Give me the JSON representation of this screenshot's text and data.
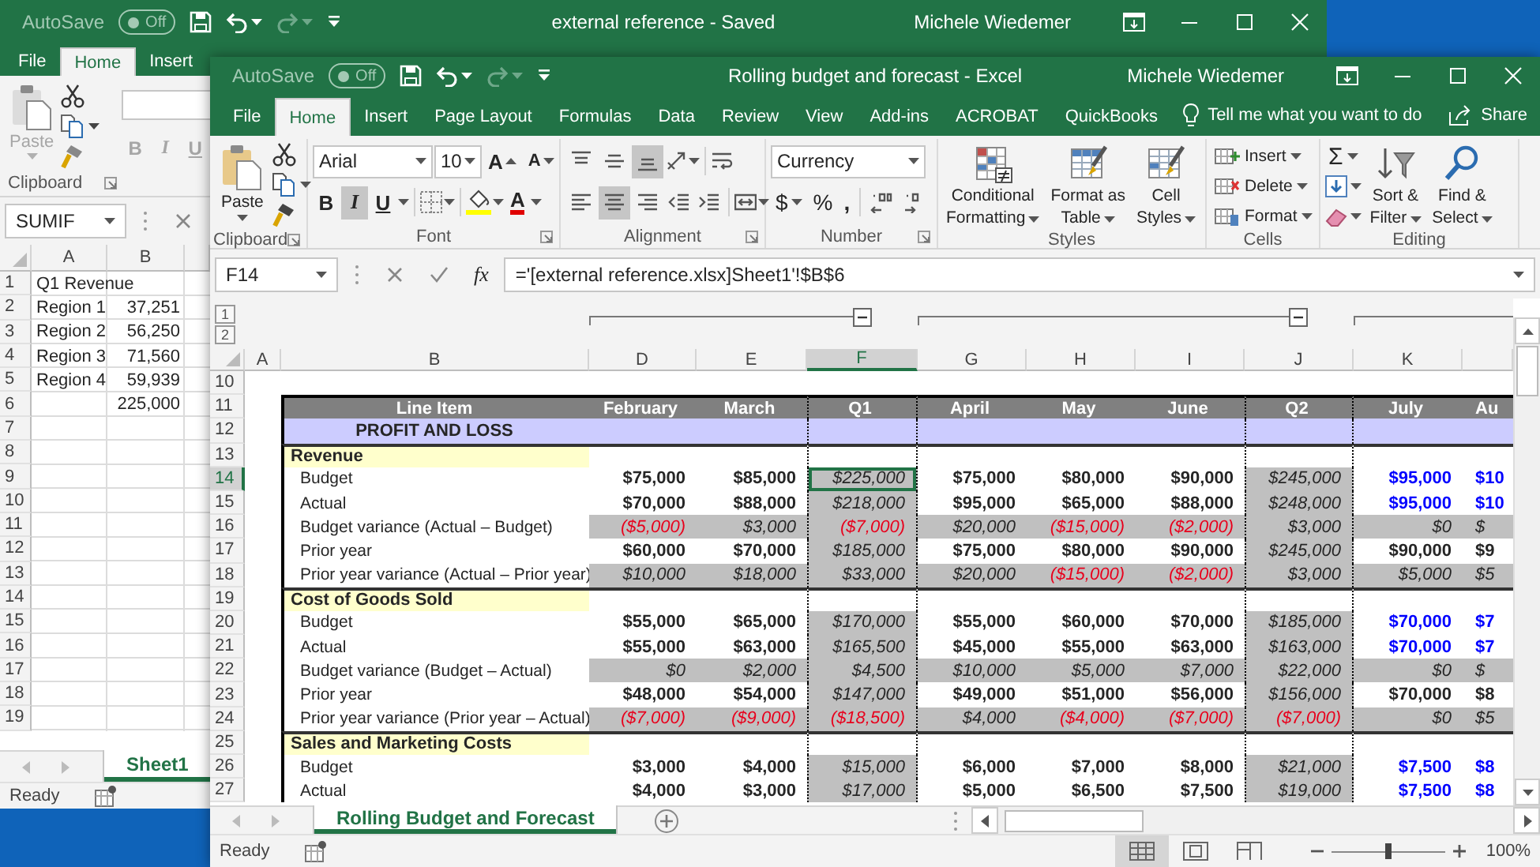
{
  "back_window": {
    "title_bar": {
      "autosave": {
        "label": "AutoSave",
        "state_text": "Off",
        "on": false
      },
      "title": "external reference - Saved",
      "user": "Michele Wiedemer"
    },
    "tabs": [
      {
        "label": "File",
        "selected": false
      },
      {
        "label": "Home",
        "selected": true
      },
      {
        "label": "Insert",
        "selected": false
      }
    ],
    "ribbon": {
      "disabled": true,
      "paste": "Paste",
      "group_label": "Clipboard",
      "styles": [
        "B",
        "I",
        "U"
      ]
    },
    "formula_bar": {
      "name_box": "SUMIF"
    },
    "sheet": {
      "columns": [
        "A",
        "B"
      ],
      "rows": [
        {
          "number": "1",
          "a": "Q1 Revenue"
        },
        {
          "number": "2",
          "a": "Region 1",
          "b": "37,251"
        },
        {
          "number": "3",
          "a": "Region 2",
          "b": "56,250"
        },
        {
          "number": "4",
          "a": "Region 3",
          "b": "71,560"
        },
        {
          "number": "5",
          "a": "Region 4",
          "b": "59,939"
        },
        {
          "number": "6",
          "b": "225,000"
        },
        {
          "number": "7"
        },
        {
          "number": "8"
        },
        {
          "number": "9"
        },
        {
          "number": "10"
        },
        {
          "number": "11"
        },
        {
          "number": "12"
        },
        {
          "number": "13"
        },
        {
          "number": "14"
        },
        {
          "number": "15"
        },
        {
          "number": "16"
        },
        {
          "number": "17"
        },
        {
          "number": "18"
        },
        {
          "number": "19"
        }
      ]
    },
    "sheet_tabs": [
      {
        "label": "Sheet1",
        "selected": true
      }
    ],
    "status": {
      "text": "Ready"
    }
  },
  "front_window": {
    "title_bar": {
      "autosave": {
        "label": "AutoSave",
        "state_text": "Off",
        "on": false
      },
      "title": "Rolling budget and forecast - Excel",
      "user": "Michele Wiedemer"
    },
    "tabs": [
      {
        "label": "File",
        "selected": false
      },
      {
        "label": "Home",
        "selected": true
      },
      {
        "label": "Insert",
        "selected": false
      },
      {
        "label": "Page Layout",
        "selected": false
      },
      {
        "label": "Formulas",
        "selected": false
      },
      {
        "label": "Data",
        "selected": false
      },
      {
        "label": "Review",
        "selected": false
      },
      {
        "label": "View",
        "selected": false
      },
      {
        "label": "Add-ins",
        "selected": false
      },
      {
        "label": "ACROBAT",
        "selected": false
      },
      {
        "label": "QuickBooks",
        "selected": false
      }
    ],
    "tell_me": "Tell me what you want to do",
    "share": "Share",
    "ribbon": {
      "groups": [
        {
          "kind": "clipboard",
          "label": "Clipboard",
          "launcher": true,
          "paste": "Paste"
        },
        {
          "kind": "font",
          "label": "Font",
          "launcher": true,
          "font_name": "Arial",
          "font_size": "10",
          "grow_label": "A",
          "shrink_label": "A",
          "styles": [
            {
              "glyph": "B",
              "selected": false
            },
            {
              "glyph": "I",
              "selected": true
            },
            {
              "glyph": "U",
              "selected": false
            }
          ],
          "color_label": "A"
        },
        {
          "kind": "alignment",
          "label": "Alignment",
          "launcher": true,
          "vertical": [
            {
              "selected": false
            },
            {
              "selected": false
            },
            {
              "selected": true
            }
          ],
          "horizontal": [
            {
              "selected": false
            },
            {
              "selected": true
            },
            {
              "selected": false
            }
          ]
        },
        {
          "kind": "number",
          "label": "Number",
          "launcher": true,
          "format": "Currency",
          "symbols": [
            "$",
            "%",
            ","
          ]
        },
        {
          "kind": "styles",
          "label": "Styles",
          "launcher": false,
          "buttons": [
            {
              "kind": "conditional",
              "lines": [
                "Conditional",
                "Formatting"
              ]
            },
            {
              "kind": "table",
              "lines": [
                "Format as",
                "Table"
              ]
            },
            {
              "kind": "cell_styles",
              "lines": [
                "Cell",
                "Styles"
              ]
            }
          ]
        },
        {
          "kind": "cells",
          "label": "Cells",
          "launcher": false,
          "buttons": [
            {
              "kind": "insert",
              "label": "Insert"
            },
            {
              "kind": "delete",
              "label": "Delete"
            },
            {
              "kind": "format",
              "label": "Format"
            }
          ]
        },
        {
          "kind": "editing",
          "label": "Editing",
          "launcher": false,
          "autosum": "Σ",
          "buttons": [
            {
              "kind": "sort",
              "lines": [
                "Sort &",
                "Filter"
              ]
            },
            {
              "kind": "find",
              "lines": [
                "Find &",
                "Select"
              ]
            }
          ]
        }
      ]
    },
    "formula_bar": {
      "name_box": "F14",
      "function_label": "fx",
      "formula": "='[external reference.xlsx]Sheet1'!$B$6"
    },
    "outline": {
      "levels": [
        "1",
        "2"
      ],
      "groups": [
        {
          "expanded": true
        },
        {
          "expanded": true
        }
      ]
    },
    "sheet": {
      "fixed_columns": [
        "A",
        "B"
      ],
      "columns": [
        {
          "letter": "D",
          "quarter": false,
          "selected": false
        },
        {
          "letter": "E",
          "quarter": false,
          "selected": false
        },
        {
          "letter": "F",
          "quarter": true,
          "selected": true
        },
        {
          "letter": "G",
          "quarter": false,
          "selected": false
        },
        {
          "letter": "H",
          "quarter": false,
          "selected": false
        },
        {
          "letter": "I",
          "quarter": false,
          "selected": false
        },
        {
          "letter": "J",
          "quarter": true,
          "selected": false
        },
        {
          "letter": "K",
          "quarter": false,
          "selected": false
        },
        {
          "quarter": false,
          "selected": false
        }
      ],
      "rows": [
        {
          "number": "10",
          "kind": "blank",
          "selected": false
        },
        {
          "number": "11",
          "kind": "header",
          "selected": false,
          "label": "Line Item",
          "cells": [
            {
              "text": "February"
            },
            {
              "text": "March"
            },
            {
              "text": "Q1"
            },
            {
              "text": "April"
            },
            {
              "text": "May"
            },
            {
              "text": "June"
            },
            {
              "text": "Q2"
            },
            {
              "text": "July"
            },
            {
              "text": "Au"
            }
          ]
        },
        {
          "number": "12",
          "kind": "title",
          "selected": false,
          "label": "PROFIT AND LOSS"
        },
        {
          "number": "13",
          "kind": "section",
          "selected": false,
          "label": "Revenue"
        },
        {
          "number": "14",
          "kind": "line",
          "selected": true,
          "label": "Budget",
          "cells": [
            {
              "text": "$75,000",
              "kind": "plain"
            },
            {
              "text": "$85,000",
              "kind": "plain"
            },
            {
              "text": "$225,000",
              "kind": "plain"
            },
            {
              "text": "$75,000",
              "kind": "plain"
            },
            {
              "text": "$80,000",
              "kind": "plain"
            },
            {
              "text": "$90,000",
              "kind": "plain"
            },
            {
              "text": "$245,000",
              "kind": "plain"
            },
            {
              "text": "$95,000",
              "kind": "forecast"
            },
            {
              "text": "$10",
              "kind": "forecast"
            }
          ]
        },
        {
          "number": "15",
          "kind": "line",
          "selected": false,
          "label": "Actual",
          "cells": [
            {
              "text": "$70,000",
              "kind": "plain"
            },
            {
              "text": "$88,000",
              "kind": "plain"
            },
            {
              "text": "$218,000",
              "kind": "plain"
            },
            {
              "text": "$95,000",
              "kind": "plain"
            },
            {
              "text": "$65,000",
              "kind": "plain"
            },
            {
              "text": "$88,000",
              "kind": "plain"
            },
            {
              "text": "$248,000",
              "kind": "plain"
            },
            {
              "text": "$95,000",
              "kind": "forecast"
            },
            {
              "text": "$10",
              "kind": "forecast"
            }
          ]
        },
        {
          "number": "16",
          "kind": "variance",
          "selected": false,
          "label": "Budget variance (Actual – Budget)",
          "cells": [
            {
              "text": "($5,000)",
              "kind": "negative"
            },
            {
              "text": "$3,000",
              "kind": "plain"
            },
            {
              "text": "($7,000)",
              "kind": "negative"
            },
            {
              "text": "$20,000",
              "kind": "plain"
            },
            {
              "text": "($15,000)",
              "kind": "negative"
            },
            {
              "text": "($2,000)",
              "kind": "negative"
            },
            {
              "text": "$3,000",
              "kind": "plain"
            },
            {
              "text": "$0",
              "kind": "plain"
            },
            {
              "text": "$",
              "kind": "plain"
            }
          ]
        },
        {
          "number": "17",
          "kind": "line",
          "selected": false,
          "label": "Prior year",
          "cells": [
            {
              "text": "$60,000",
              "kind": "plain"
            },
            {
              "text": "$70,000",
              "kind": "plain"
            },
            {
              "text": "$185,000",
              "kind": "plain"
            },
            {
              "text": "$75,000",
              "kind": "plain"
            },
            {
              "text": "$80,000",
              "kind": "plain"
            },
            {
              "text": "$90,000",
              "kind": "plain"
            },
            {
              "text": "$245,000",
              "kind": "plain"
            },
            {
              "text": "$90,000",
              "kind": "plain"
            },
            {
              "text": "$9",
              "kind": "plain"
            }
          ]
        },
        {
          "number": "18",
          "kind": "variance",
          "selected": false,
          "label": "Prior year variance (Actual – Prior year)",
          "cells": [
            {
              "text": "$10,000",
              "kind": "plain"
            },
            {
              "text": "$18,000",
              "kind": "plain"
            },
            {
              "text": "$33,000",
              "kind": "plain"
            },
            {
              "text": "$20,000",
              "kind": "plain"
            },
            {
              "text": "($15,000)",
              "kind": "negative"
            },
            {
              "text": "($2,000)",
              "kind": "negative"
            },
            {
              "text": "$3,000",
              "kind": "plain"
            },
            {
              "text": "$5,000",
              "kind": "plain"
            },
            {
              "text": "$5",
              "kind": "plain"
            }
          ]
        },
        {
          "number": "19",
          "kind": "section",
          "selected": false,
          "label": "Cost of Goods Sold"
        },
        {
          "number": "20",
          "kind": "line",
          "selected": false,
          "label": "Budget",
          "cells": [
            {
              "text": "$55,000",
              "kind": "plain"
            },
            {
              "text": "$65,000",
              "kind": "plain"
            },
            {
              "text": "$170,000",
              "kind": "plain"
            },
            {
              "text": "$55,000",
              "kind": "plain"
            },
            {
              "text": "$60,000",
              "kind": "plain"
            },
            {
              "text": "$70,000",
              "kind": "plain"
            },
            {
              "text": "$185,000",
              "kind": "plain"
            },
            {
              "text": "$70,000",
              "kind": "forecast"
            },
            {
              "text": "$7",
              "kind": "forecast"
            }
          ]
        },
        {
          "number": "21",
          "kind": "line",
          "selected": false,
          "label": "Actual",
          "cells": [
            {
              "text": "$55,000",
              "kind": "plain"
            },
            {
              "text": "$63,000",
              "kind": "plain"
            },
            {
              "text": "$165,500",
              "kind": "plain"
            },
            {
              "text": "$45,000",
              "kind": "plain"
            },
            {
              "text": "$55,000",
              "kind": "plain"
            },
            {
              "text": "$63,000",
              "kind": "plain"
            },
            {
              "text": "$163,000",
              "kind": "plain"
            },
            {
              "text": "$70,000",
              "kind": "forecast"
            },
            {
              "text": "$7",
              "kind": "forecast"
            }
          ]
        },
        {
          "number": "22",
          "kind": "variance",
          "selected": false,
          "label": "Budget variance (Budget – Actual)",
          "cells": [
            {
              "text": "$0",
              "kind": "plain"
            },
            {
              "text": "$2,000",
              "kind": "plain"
            },
            {
              "text": "$4,500",
              "kind": "plain"
            },
            {
              "text": "$10,000",
              "kind": "plain"
            },
            {
              "text": "$5,000",
              "kind": "plain"
            },
            {
              "text": "$7,000",
              "kind": "plain"
            },
            {
              "text": "$22,000",
              "kind": "plain"
            },
            {
              "text": "$0",
              "kind": "plain"
            },
            {
              "text": "$",
              "kind": "plain"
            }
          ]
        },
        {
          "number": "23",
          "kind": "line",
          "selected": false,
          "label": "Prior year",
          "cells": [
            {
              "text": "$48,000",
              "kind": "plain"
            },
            {
              "text": "$54,000",
              "kind": "plain"
            },
            {
              "text": "$147,000",
              "kind": "plain"
            },
            {
              "text": "$49,000",
              "kind": "plain"
            },
            {
              "text": "$51,000",
              "kind": "plain"
            },
            {
              "text": "$56,000",
              "kind": "plain"
            },
            {
              "text": "$156,000",
              "kind": "plain"
            },
            {
              "text": "$70,000",
              "kind": "plain"
            },
            {
              "text": "$8",
              "kind": "plain"
            }
          ]
        },
        {
          "number": "24",
          "kind": "variance",
          "selected": false,
          "label": "Prior year variance (Prior year – Actual)",
          "cells": [
            {
              "text": "($7,000)",
              "kind": "negative"
            },
            {
              "text": "($9,000)",
              "kind": "negative"
            },
            {
              "text": "($18,500)",
              "kind": "negative"
            },
            {
              "text": "$4,000",
              "kind": "plain"
            },
            {
              "text": "($4,000)",
              "kind": "negative"
            },
            {
              "text": "($7,000)",
              "kind": "negative"
            },
            {
              "text": "($7,000)",
              "kind": "negative"
            },
            {
              "text": "$0",
              "kind": "plain"
            },
            {
              "text": "$5",
              "kind": "plain"
            }
          ]
        },
        {
          "number": "25",
          "kind": "section",
          "selected": false,
          "label": "Sales and Marketing Costs"
        },
        {
          "number": "26",
          "kind": "line",
          "selected": false,
          "label": "Budget",
          "cells": [
            {
              "text": "$3,000",
              "kind": "plain"
            },
            {
              "text": "$4,000",
              "kind": "plain"
            },
            {
              "text": "$15,000",
              "kind": "plain"
            },
            {
              "text": "$6,000",
              "kind": "plain"
            },
            {
              "text": "$7,000",
              "kind": "plain"
            },
            {
              "text": "$8,000",
              "kind": "plain"
            },
            {
              "text": "$21,000",
              "kind": "plain"
            },
            {
              "text": "$7,500",
              "kind": "forecast"
            },
            {
              "text": "$8",
              "kind": "forecast"
            }
          ]
        },
        {
          "number": "27",
          "kind": "line",
          "selected": false,
          "label": "Actual",
          "cells": [
            {
              "text": "$4,000",
              "kind": "plain"
            },
            {
              "text": "$3,000",
              "kind": "plain"
            },
            {
              "text": "$17,000",
              "kind": "plain"
            },
            {
              "text": "$5,000",
              "kind": "plain"
            },
            {
              "text": "$6,500",
              "kind": "plain"
            },
            {
              "text": "$7,500",
              "kind": "plain"
            },
            {
              "text": "$19,000",
              "kind": "plain"
            },
            {
              "text": "$7,500",
              "kind": "forecast"
            },
            {
              "text": "$8",
              "kind": "forecast"
            }
          ]
        }
      ]
    },
    "sheet_tabs": [
      {
        "label": "Rolling Budget and Forecast",
        "selected": true
      }
    ],
    "status": {
      "text": "Ready",
      "views": [
        {
          "kind": "normal",
          "selected": true
        },
        {
          "kind": "page_layout",
          "selected": false
        },
        {
          "kind": "page_break",
          "selected": false
        }
      ],
      "zoom": {
        "level": 0.5,
        "reading": "100%"
      }
    }
  }
}
